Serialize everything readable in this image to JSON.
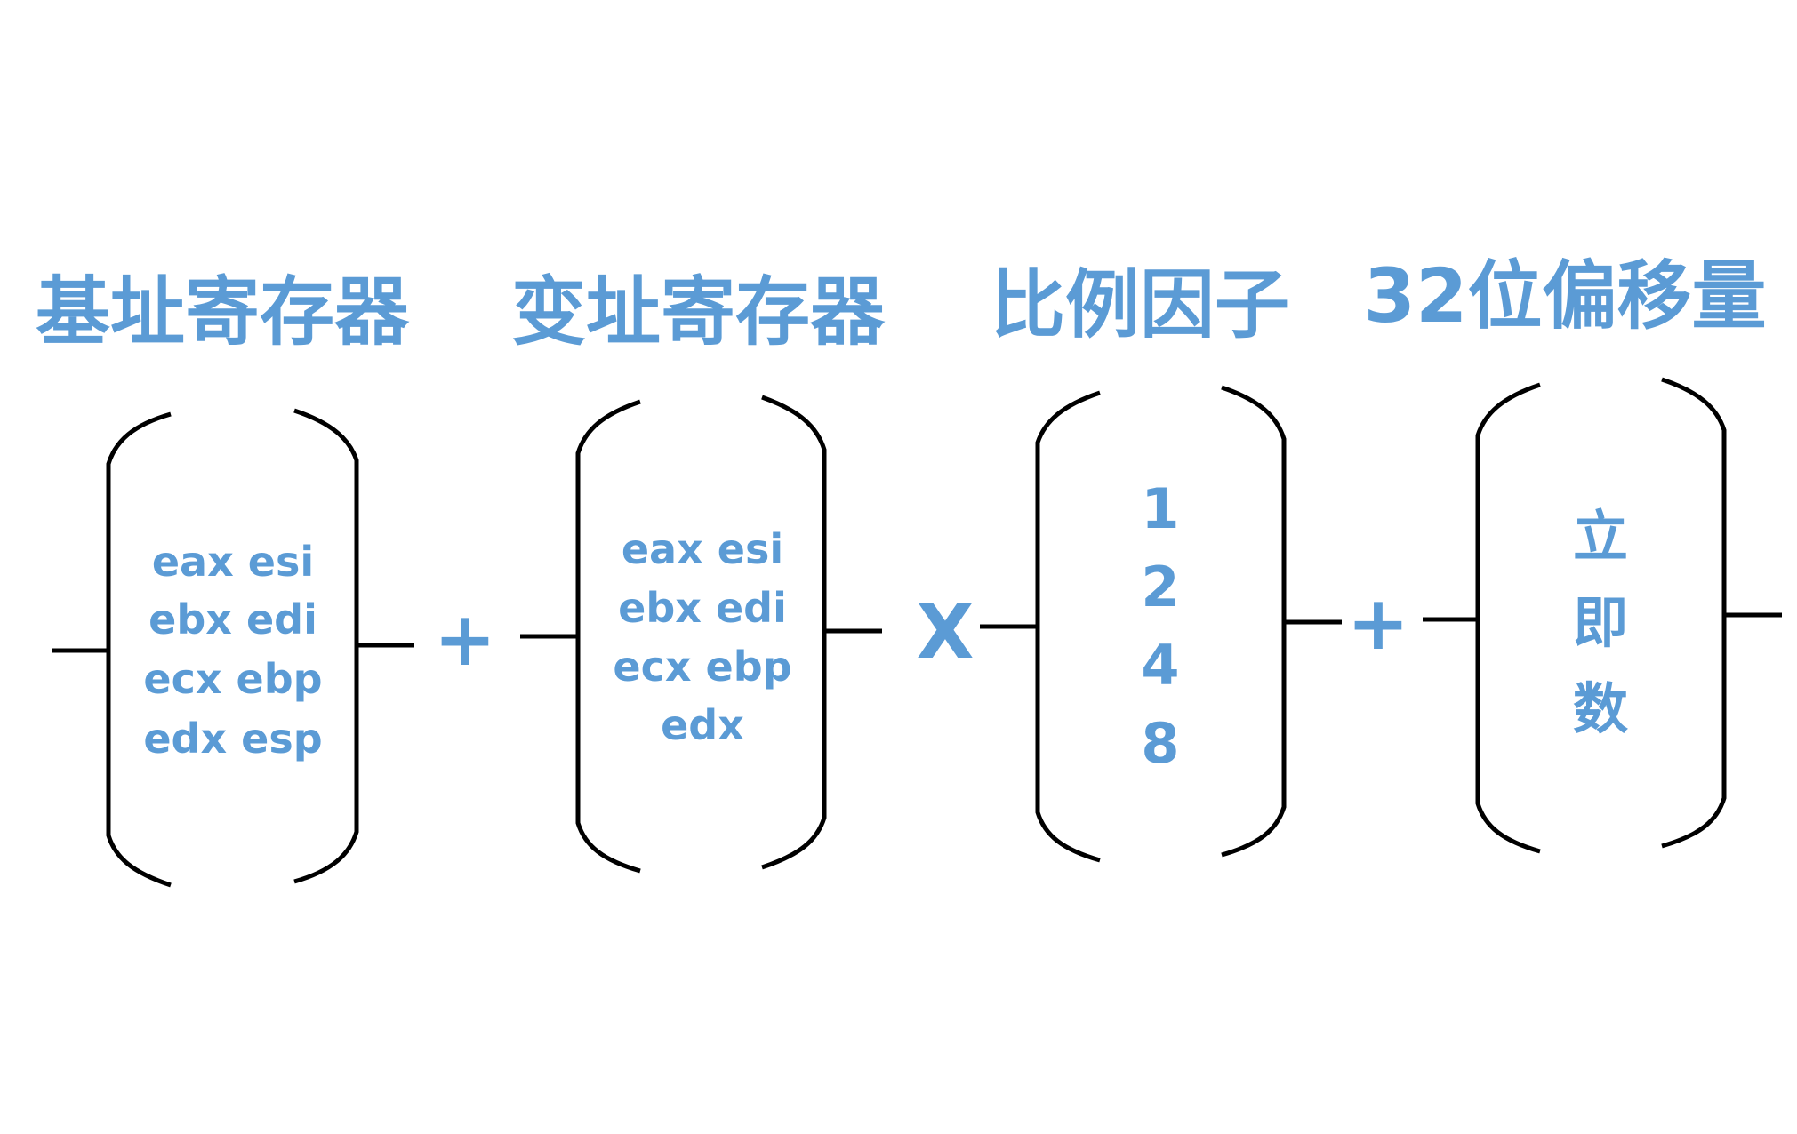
{
  "headings": {
    "base_register": "基址寄存器",
    "index_register": "变址寄存器",
    "scale_factor": "比例因子",
    "displacement": "32位偏移量"
  },
  "operators": {
    "plus_1": "+",
    "times": "X",
    "plus_2": "+"
  },
  "base_registers": [
    "eax esi",
    "ebx edi",
    "ecx ebp",
    "edx esp"
  ],
  "index_registers": [
    "eax esi",
    "ebx edi",
    "ecx ebp",
    "edx"
  ],
  "scale_values": [
    "1",
    "2",
    "4",
    "8"
  ],
  "displacement_chars": [
    "立",
    "即",
    "数"
  ],
  "colors": {
    "text": "#5b9bd5",
    "lines": "#000000"
  }
}
